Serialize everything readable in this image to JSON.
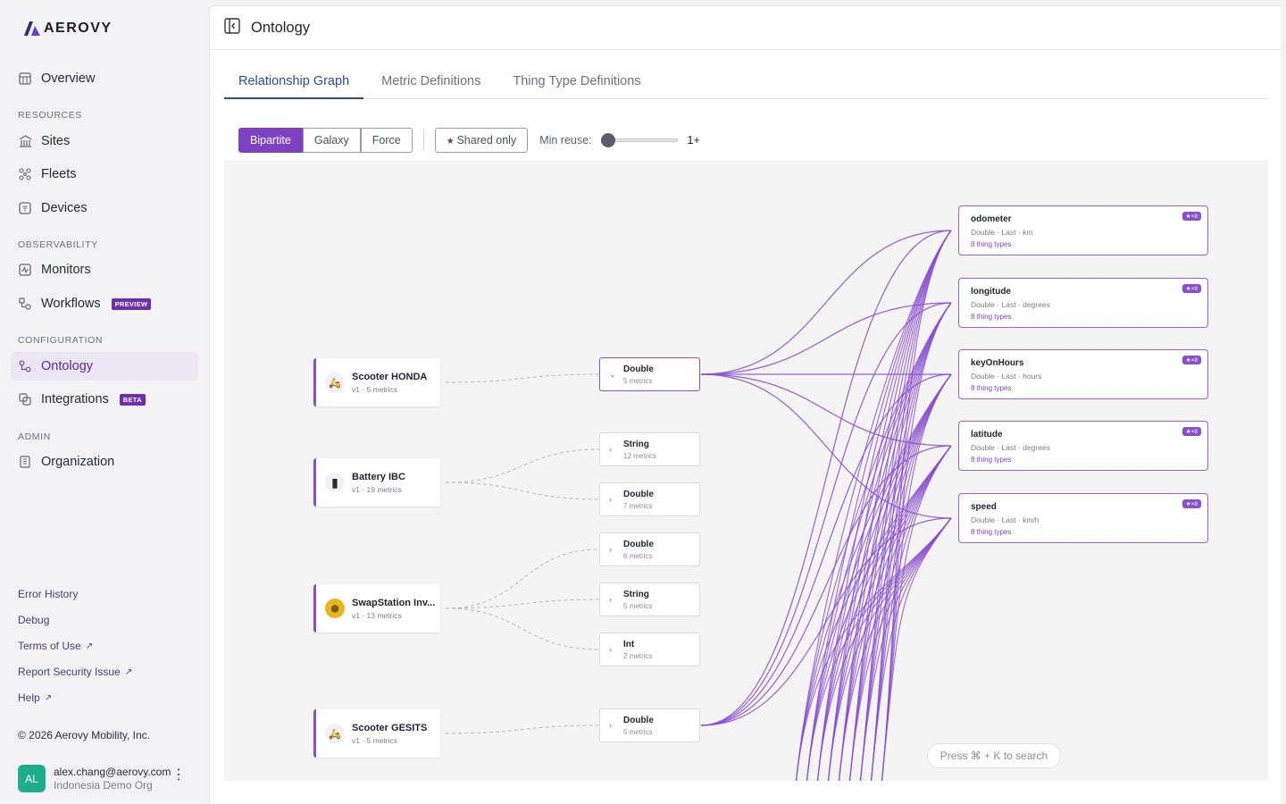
{
  "brand": {
    "name": "AEROVY"
  },
  "sidebar": {
    "overview": "Overview",
    "sections": {
      "resources": "RESOURCES",
      "observability": "OBSERVABILITY",
      "configuration": "CONFIGURATION",
      "admin": "ADMIN"
    },
    "items": {
      "sites": "Sites",
      "fleets": "Fleets",
      "devices": "Devices",
      "monitors": "Monitors",
      "workflows": "Workflows",
      "workflows_badge": "PREVIEW",
      "ontology": "Ontology",
      "integrations": "Integrations",
      "integrations_badge": "BETA",
      "organization": "Organization"
    },
    "footer": {
      "error_history": "Error History",
      "debug": "Debug",
      "terms": "Terms of Use",
      "report_security": "Report Security Issue",
      "help": "Help",
      "copyright": "© 2026 Aerovy Mobility, Inc."
    },
    "user": {
      "initials": "AL",
      "email": "alex.chang@aerovy.com",
      "org": "Indonesia Demo Org"
    }
  },
  "header": {
    "title": "Ontology"
  },
  "tabs": [
    "Relationship Graph",
    "Metric Definitions",
    "Thing Type Definitions"
  ],
  "toolbar": {
    "layouts": [
      "Bipartite",
      "Galaxy",
      "Force"
    ],
    "shared_only": "Shared only",
    "min_reuse_label": "Min reuse:",
    "min_reuse_value": "1+"
  },
  "graph": {
    "thing_types": [
      {
        "name": "Scooter HONDA",
        "meta": "v1 · 5 metrics",
        "icon": "scooter-icon"
      },
      {
        "name": "Battery IBC",
        "meta": "v1 · 19 metrics",
        "icon": "battery-icon"
      },
      {
        "name": "SwapStation Inv...",
        "meta": "v1 · 13 metrics",
        "icon": "swap-station-icon"
      },
      {
        "name": "Scooter GESITS",
        "meta": "v1 · 5 metrics",
        "icon": "scooter-icon"
      }
    ],
    "data_types": [
      {
        "name": "Double",
        "meta": "5 metrics",
        "expanded": true
      },
      {
        "name": "String",
        "meta": "12 metrics"
      },
      {
        "name": "Double",
        "meta": "7 metrics"
      },
      {
        "name": "Double",
        "meta": "6 metrics"
      },
      {
        "name": "String",
        "meta": "5 metrics"
      },
      {
        "name": "Int",
        "meta": "2 metrics"
      },
      {
        "name": "Double",
        "meta": "5 metrics"
      }
    ],
    "metrics": [
      {
        "name": "odometer",
        "meta": "Double · Last · km",
        "things": "8 thing types",
        "badge": "★×8"
      },
      {
        "name": "longitude",
        "meta": "Double · Last · degrees",
        "things": "8 thing types",
        "badge": "★×8"
      },
      {
        "name": "keyOnHours",
        "meta": "Double · Last · hours",
        "things": "8 thing types",
        "badge": "★×8"
      },
      {
        "name": "latitude",
        "meta": "Double · Last · degrees",
        "things": "8 thing types",
        "badge": "★×8"
      },
      {
        "name": "speed",
        "meta": "Double · Last · km/h",
        "things": "8 thing types",
        "badge": "★×8"
      }
    ]
  },
  "search_hint": "Press ⌘ + K to search",
  "colors": {
    "accent": "#7f41c4",
    "edge": "#8a4fcf",
    "tab_active": "#2c4b9b"
  }
}
